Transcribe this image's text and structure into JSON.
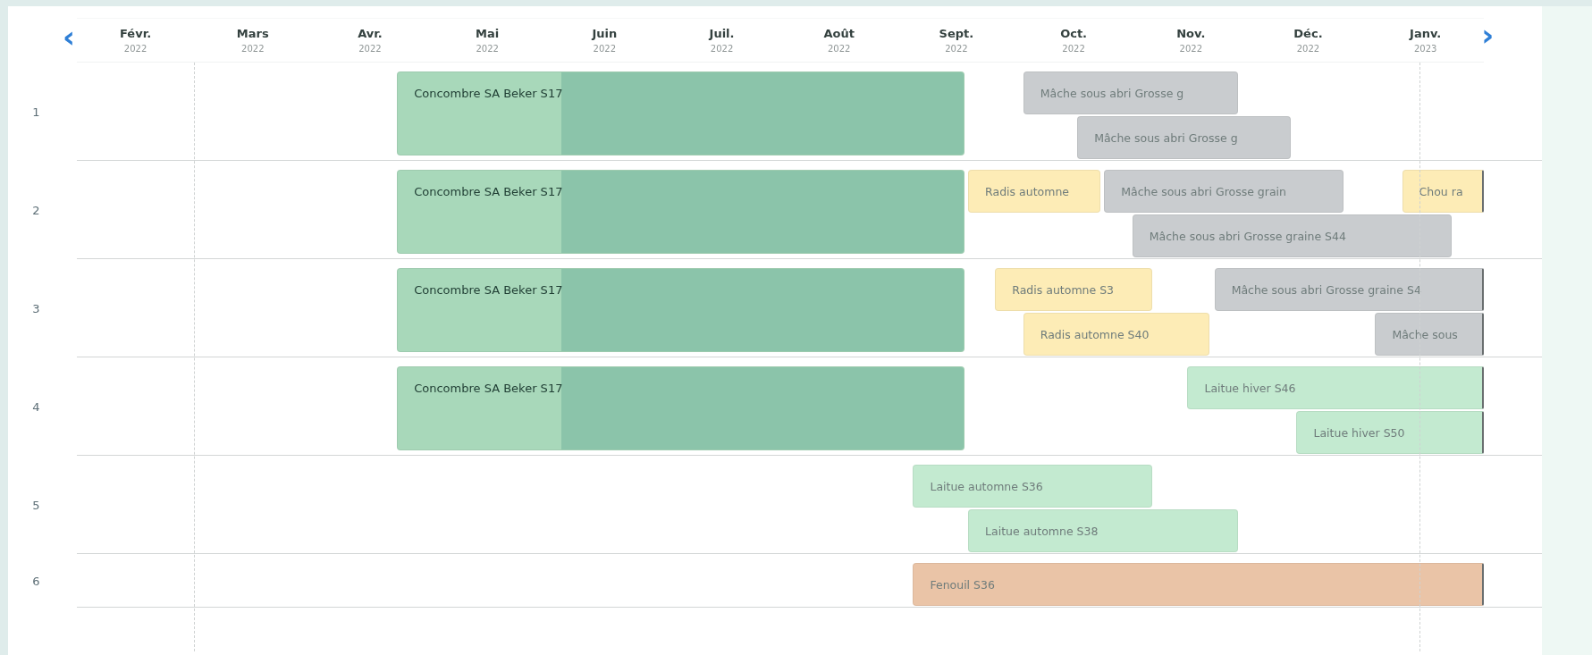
{
  "navigation": {
    "previous": "‹",
    "next": "›"
  },
  "months": [
    {
      "name": "Févr.",
      "year": "2022"
    },
    {
      "name": "Mars",
      "year": "2022"
    },
    {
      "name": "Avr.",
      "year": "2022"
    },
    {
      "name": "Mai",
      "year": "2022"
    },
    {
      "name": "Juin",
      "year": "2022"
    },
    {
      "name": "Juil.",
      "year": "2022"
    },
    {
      "name": "Août",
      "year": "2022"
    },
    {
      "name": "Sept.",
      "year": "2022"
    },
    {
      "name": "Oct.",
      "year": "2022"
    },
    {
      "name": "Nov.",
      "year": "2022"
    },
    {
      "name": "Déc.",
      "year": "2022"
    },
    {
      "name": "Janv.",
      "year": "2023"
    }
  ],
  "rows": [
    {
      "label": "1",
      "main_bar": {
        "label": "Concombre SA Beker S17",
        "color": "#a8d8ba",
        "second_phase": {
          "color": "#8bc4aa"
        }
      },
      "lanes": [
        [
          {
            "label": "Mâche sous abri Grosse g",
            "color": "#c9cccf"
          }
        ],
        [
          {
            "label": "Mâche sous abri Grosse g",
            "color": "#c9cccf"
          }
        ]
      ]
    },
    {
      "label": "2",
      "main_bar": {
        "label": "Concombre SA Beker S17",
        "color": "#a8d8ba",
        "second_phase": {
          "color": "#8bc4aa"
        }
      },
      "lanes": [
        [
          {
            "label": "Radis automne",
            "color": "#fdecb6"
          },
          {
            "label": "Mâche sous abri Grosse grain",
            "color": "#c9cccf"
          },
          {
            "label": "Chou ra",
            "color": "#fdecb6"
          }
        ],
        [
          {
            "label": "Mâche sous abri Grosse graine S44",
            "color": "#c9cccf"
          }
        ]
      ]
    },
    {
      "label": "3",
      "main_bar": {
        "label": "Concombre SA Beker S17",
        "color": "#a8d8ba",
        "second_phase": {
          "color": "#8bc4aa"
        }
      },
      "lanes": [
        [
          {
            "label": "Radis automne S3",
            "color": "#fdecb6"
          },
          {
            "label": "Mâche sous abri Grosse graine S4",
            "color": "#c9cccf"
          }
        ],
        [
          {
            "label": "Radis automne S40",
            "color": "#fdecb6"
          },
          {
            "label": "Mâche sous",
            "color": "#c9cccf"
          }
        ]
      ]
    },
    {
      "label": "4",
      "main_bar": {
        "label": "Concombre SA Beker S17",
        "color": "#a8d8ba",
        "second_phase": {
          "color": "#8bc4aa"
        }
      },
      "lanes": [
        [
          {
            "label": "Laitue hiver S46",
            "color": "#c3ead0"
          }
        ],
        [
          {
            "label": "Laitue hiver S50",
            "color": "#c3ead0"
          }
        ]
      ]
    },
    {
      "label": "5",
      "lanes": [
        [
          {
            "label": "Laitue automne S36",
            "color": "#c3ead0"
          }
        ],
        [
          {
            "label": "Laitue automne S38",
            "color": "#c3ead0"
          }
        ]
      ]
    },
    {
      "label": "6",
      "lanes": [
        [
          {
            "label": "Fenouil S36",
            "color": "#eac4a7"
          }
        ]
      ]
    }
  ]
}
